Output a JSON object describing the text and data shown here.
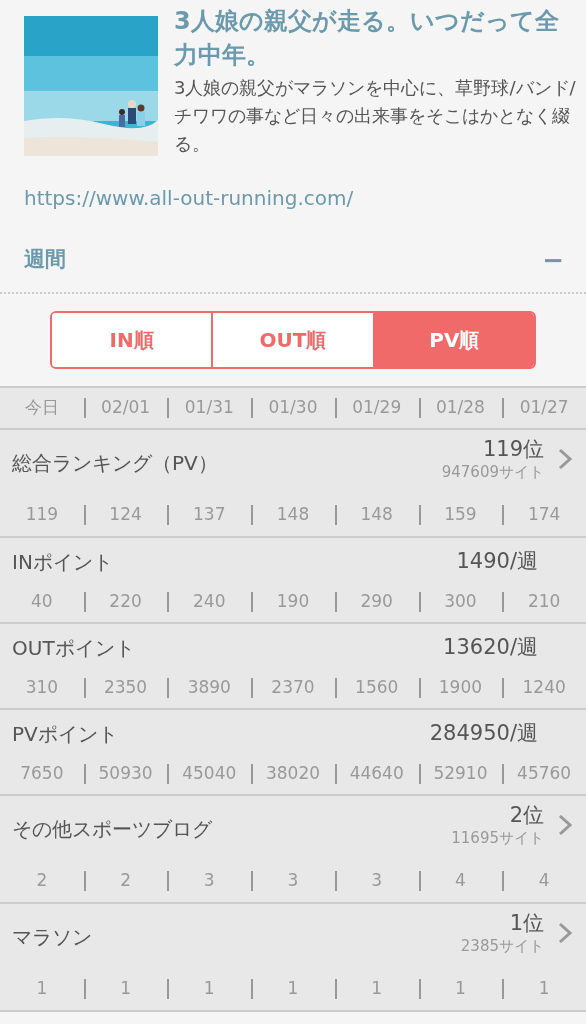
{
  "blog": {
    "title": "3人娘の親父が走る。いつだって全力中年。",
    "description": "3人娘の親父がマラソンを中心に、草野球/バンド/チワワの事など日々の出来事をそこはかとなく綴る。",
    "url": "https://www.all-out-running.com/"
  },
  "section": {
    "label": "週間",
    "collapse_icon": "−"
  },
  "sort_tabs": [
    {
      "label": "IN順",
      "selected": false
    },
    {
      "label": "OUT順",
      "selected": false
    },
    {
      "label": "PV順",
      "selected": true
    }
  ],
  "dates": [
    "今日",
    "02/01",
    "01/31",
    "01/30",
    "01/29",
    "01/28",
    "01/27"
  ],
  "rows": [
    {
      "kind": "rank",
      "label": "総合ランキング（PV）",
      "rank": "119位",
      "sites": "947609サイト",
      "history": [
        "119",
        "124",
        "137",
        "148",
        "148",
        "159",
        "174"
      ]
    },
    {
      "kind": "points",
      "label": "INポイント",
      "total": "1490/週",
      "history": [
        "40",
        "220",
        "240",
        "190",
        "290",
        "300",
        "210"
      ]
    },
    {
      "kind": "points",
      "label": "OUTポイント",
      "total": "13620/週",
      "history": [
        "310",
        "2350",
        "3890",
        "2370",
        "1560",
        "1900",
        "1240"
      ]
    },
    {
      "kind": "points",
      "label": "PVポイント",
      "total": "284950/週",
      "history": [
        "7650",
        "50930",
        "45040",
        "38020",
        "44640",
        "52910",
        "45760"
      ]
    },
    {
      "kind": "rank",
      "label": "その他スポーツブログ",
      "rank": "2位",
      "sites": "11695サイト",
      "history": [
        "2",
        "2",
        "3",
        "3",
        "3",
        "4",
        "4"
      ]
    },
    {
      "kind": "rank",
      "label": "マラソン",
      "rank": "1位",
      "sites": "2385サイト",
      "history": [
        "1",
        "1",
        "1",
        "1",
        "1",
        "1",
        "1"
      ]
    }
  ]
}
